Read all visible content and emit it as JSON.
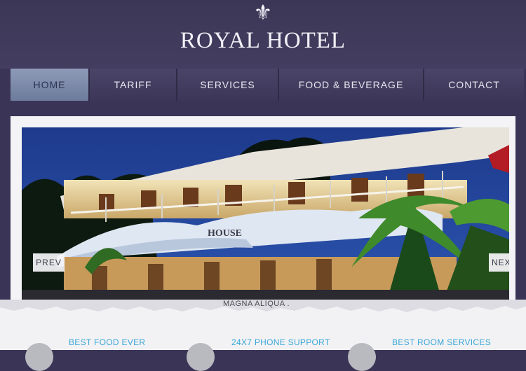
{
  "brand": {
    "logo_icon": "fleur-de-lis-icon",
    "logo_glyph": "⚜",
    "title": "ROYAL HOTEL"
  },
  "nav": {
    "items": [
      {
        "label": "HOME",
        "active": true
      },
      {
        "label": "TARIFF",
        "active": false
      },
      {
        "label": "SERVICES",
        "active": false
      },
      {
        "label": "FOOD & BEVERAGE",
        "active": false
      },
      {
        "label": "CONTACT",
        "active": false
      }
    ]
  },
  "slider": {
    "prev_label": "PREV",
    "next_label": "NEXT",
    "sign_text": "HOUSE"
  },
  "content": {
    "caption": "MAGNA ALIQUA .",
    "features": [
      {
        "title": "BEST FOOD EVER"
      },
      {
        "title": "24X7 PHONE SUPPORT"
      },
      {
        "title": "BEST ROOM SERVICES"
      }
    ]
  },
  "colors": {
    "background": "#3a3556",
    "accent": "#3aa7d6",
    "nav_active": "#7f8cad"
  }
}
